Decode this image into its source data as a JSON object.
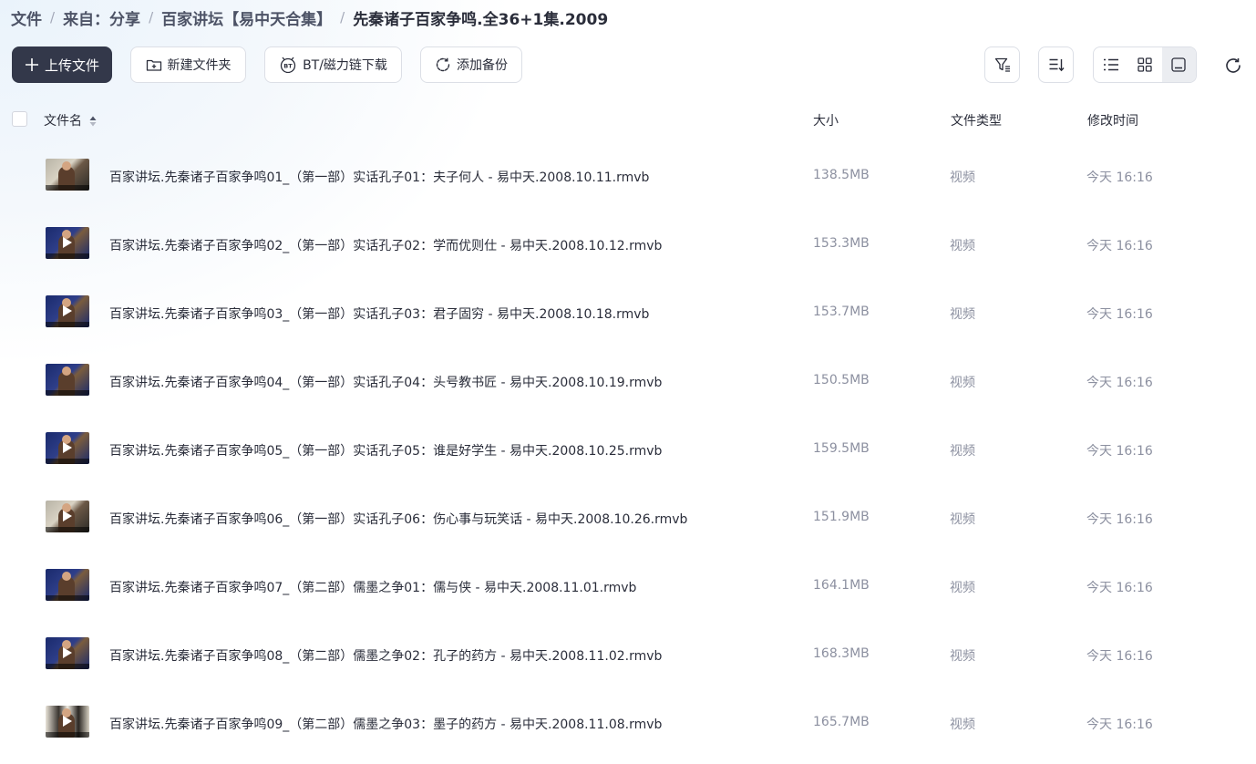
{
  "breadcrumb": {
    "items": [
      "文件",
      "来自：分享",
      "百家讲坛【易中天合集】",
      "先秦诸子百家争鸣.全36+1集.2009"
    ],
    "separator": "/"
  },
  "toolbar": {
    "upload_label": "上传文件",
    "new_folder_label": "新建文件夹",
    "bt_label": "BT/磁力链下载",
    "backup_label": "添加备份"
  },
  "table": {
    "columns": {
      "name": "文件名",
      "size": "大小",
      "type": "文件类型",
      "modified": "修改时间"
    },
    "rows": [
      {
        "name": "百家讲坛.先秦诸子百家争鸣01_（第一部）实话孔子01：夫子何人 - 易中天.2008.10.11.rmvb",
        "size": "138.5MB",
        "type": "视频",
        "modified": "今天 16:16",
        "thumb": "light",
        "play": false
      },
      {
        "name": "百家讲坛.先秦诸子百家争鸣02_（第一部）实话孔子02：学而优则仕 - 易中天.2008.10.12.rmvb",
        "size": "153.3MB",
        "type": "视频",
        "modified": "今天 16:16",
        "thumb": "dark",
        "play": true
      },
      {
        "name": "百家讲坛.先秦诸子百家争鸣03_（第一部）实话孔子03：君子固穷 - 易中天.2008.10.18.rmvb",
        "size": "153.7MB",
        "type": "视频",
        "modified": "今天 16:16",
        "thumb": "dark",
        "play": true
      },
      {
        "name": "百家讲坛.先秦诸子百家争鸣04_（第一部）实话孔子04：头号教书匠 - 易中天.2008.10.19.rmvb",
        "size": "150.5MB",
        "type": "视频",
        "modified": "今天 16:16",
        "thumb": "dark",
        "play": false
      },
      {
        "name": "百家讲坛.先秦诸子百家争鸣05_（第一部）实话孔子05：谁是好学生 - 易中天.2008.10.25.rmvb",
        "size": "159.5MB",
        "type": "视频",
        "modified": "今天 16:16",
        "thumb": "dark",
        "play": true
      },
      {
        "name": "百家讲坛.先秦诸子百家争鸣06_（第一部）实话孔子06：伤心事与玩笑话 - 易中天.2008.10.26.rmvb",
        "size": "151.9MB",
        "type": "视频",
        "modified": "今天 16:16",
        "thumb": "light",
        "play": true
      },
      {
        "name": "百家讲坛.先秦诸子百家争鸣07_（第二部）儒墨之争01：儒与侠 - 易中天.2008.11.01.rmvb",
        "size": "164.1MB",
        "type": "视频",
        "modified": "今天 16:16",
        "thumb": "dark",
        "play": false
      },
      {
        "name": "百家讲坛.先秦诸子百家争鸣08_（第二部）儒墨之争02：孔子的药方 - 易中天.2008.11.02.rmvb",
        "size": "168.3MB",
        "type": "视频",
        "modified": "今天 16:16",
        "thumb": "dark",
        "play": true
      },
      {
        "name": "百家讲坛.先秦诸子百家争鸣09_（第二部）儒墨之争03：墨子的药方 - 易中天.2008.11.08.rmvb",
        "size": "165.7MB",
        "type": "视频",
        "modified": "今天 16:16",
        "thumb": "bw",
        "play": true
      }
    ]
  }
}
